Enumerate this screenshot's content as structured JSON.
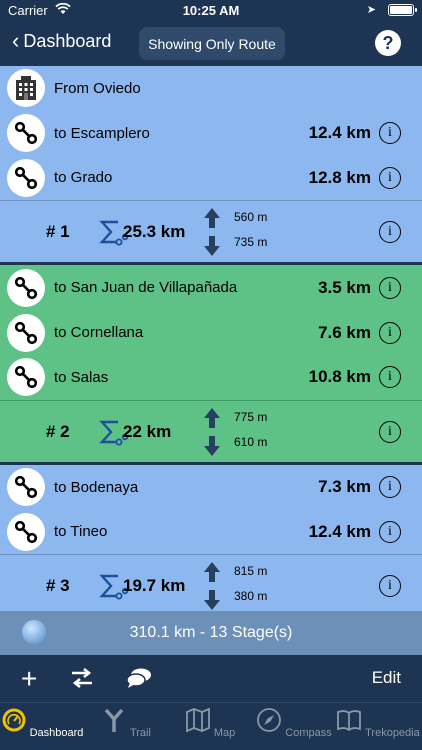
{
  "status": {
    "carrier": "Carrier",
    "time": "10:25 AM"
  },
  "nav": {
    "back_label": "Dashboard",
    "title_pill": "Showing Only Route",
    "help_label": "?"
  },
  "origin": {
    "name": "From Oviedo",
    "icon": "building-icon"
  },
  "stages": [
    {
      "color": "#8db8ef",
      "legs": [
        {
          "name": "to Escamplero",
          "distance": "12.4 km"
        },
        {
          "name": "to Grado",
          "distance": "12.8 km"
        }
      ],
      "summary": {
        "number": "# 1",
        "total": "25.3 km",
        "ascent": "560 m",
        "descent": "735 m"
      }
    },
    {
      "color": "#5ec287",
      "legs": [
        {
          "name": "to San Juan de Villapañada",
          "distance": "3.5 km"
        },
        {
          "name": "to Cornellana",
          "distance": "7.6 km"
        },
        {
          "name": "to Salas",
          "distance": "10.8 km"
        }
      ],
      "summary": {
        "number": "# 2",
        "total": "22 km",
        "ascent": "775 m",
        "descent": "610 m"
      }
    },
    {
      "color": "#8db8ef",
      "legs": [
        {
          "name": "to Bodenaya",
          "distance": "7.3 km"
        },
        {
          "name": "to Tineo",
          "distance": "12.4 km"
        }
      ],
      "summary": {
        "number": "# 3",
        "total": "19.7 km",
        "ascent": "815 m",
        "descent": "380 m"
      }
    }
  ],
  "route_summary": "310.1 km - 13 Stage(s)",
  "toolbar": {
    "edit_label": "Edit"
  },
  "tabs": [
    {
      "label": "Dashboard",
      "icon": "gauge-icon",
      "active": true
    },
    {
      "label": "Trail",
      "icon": "trail-icon",
      "active": false
    },
    {
      "label": "Map",
      "icon": "map-icon",
      "active": false
    },
    {
      "label": "Compass",
      "icon": "compass-icon",
      "active": false
    },
    {
      "label": "Trekopedia",
      "icon": "book-icon",
      "active": false
    }
  ]
}
